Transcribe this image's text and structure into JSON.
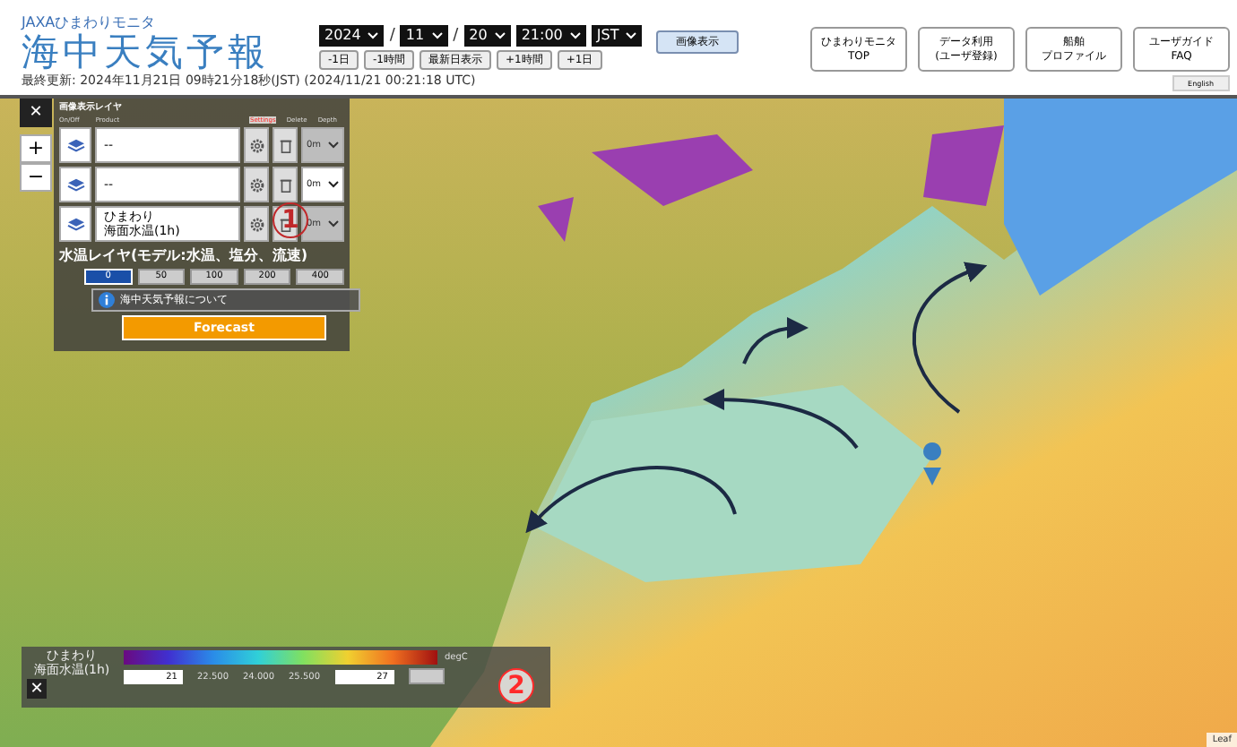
{
  "header": {
    "logo_sub": "JAXAひまわりモニタ",
    "logo_title": "海中天気予報",
    "last_updated": "最終更新: 2024年11月21日 09時21分18秒(JST) (2024/11/21 00:21:18 UTC)",
    "date_selects": [
      {
        "value": "2024",
        "separator_after": "/"
      },
      {
        "value": "11",
        "separator_after": "/"
      },
      {
        "value": "20"
      },
      {
        "value": "21:00"
      },
      {
        "value": "JST"
      }
    ],
    "step_buttons": [
      "-1日",
      "-1時間",
      "最新日表示",
      "+1時間",
      "+1日"
    ],
    "show_image_button": "画像表示",
    "nav_buttons": [
      {
        "lines": [
          "ひまわりモニタ",
          "TOP"
        ]
      },
      {
        "lines": [
          "データ利用",
          "(ユーザ登録)"
        ]
      },
      {
        "lines": [
          "船舶",
          "プロファイル"
        ]
      },
      {
        "lines": [
          "ユーザガイド",
          "FAQ"
        ]
      }
    ],
    "language_button": "English"
  },
  "map_controls": {
    "zoom_in": "+",
    "zoom_out": "−",
    "close": "✕"
  },
  "layer_panel": {
    "title": "画像表示レイヤ",
    "columns": [
      "On/Off",
      "Product",
      "Settings",
      "Delete",
      "Depth"
    ],
    "layers": [
      {
        "product": "--",
        "depth": "0m",
        "depth_disabled": true
      },
      {
        "product": "--",
        "depth": "0m",
        "depth_disabled": false
      },
      {
        "product_sub": "ひまわり",
        "product": "海面水温(1h)",
        "depth": "0m",
        "depth_disabled": true
      }
    ],
    "annotation": "1",
    "depth_label": "水温レイヤ(モデル:水温、塩分、流速)",
    "depths": [
      {
        "label": "0",
        "selected": true
      },
      {
        "label": "50",
        "selected": false
      },
      {
        "label": "100",
        "selected": false
      },
      {
        "label": "200",
        "selected": false
      },
      {
        "label": "400",
        "selected": false
      }
    ],
    "info_link": "海中天気予報について",
    "forecast_button": "Forecast"
  },
  "colorbar": {
    "label_sub": "ひまわり",
    "label": "海面水温(1h)",
    "unit": "degC",
    "close": "✕",
    "min": "21",
    "ticks": [
      "22.500",
      "24.000",
      "25.500"
    ],
    "max": "27",
    "annotation": "2"
  },
  "attribution": "Leaf"
}
